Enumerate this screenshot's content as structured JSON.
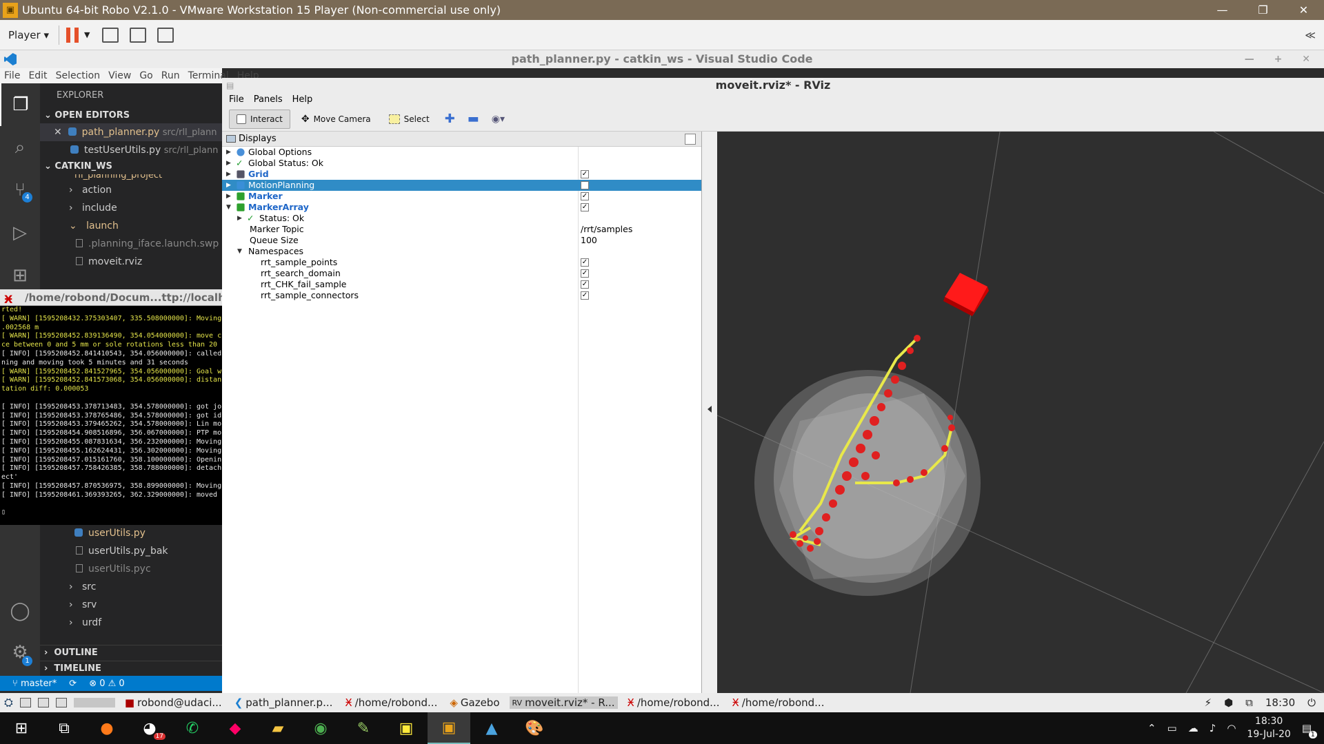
{
  "vm": {
    "title": "Ubuntu 64-bit Robo V2.1.0 - VMware Workstation 15 Player (Non-commercial use only)",
    "player_label": "Player",
    "controls": [
      "—",
      "❐",
      "✕"
    ],
    "fullscreen_toggle": "≪"
  },
  "vscode": {
    "title": "path_planner.py - catkin_ws - Visual Studio Code",
    "menu": [
      "File",
      "Edit",
      "Selection",
      "View",
      "Go",
      "Run",
      "Terminal",
      "Help"
    ],
    "explorer_label": "EXPLORER",
    "open_editors_label": "OPEN EDITORS",
    "open_editors": [
      {
        "name": "path_planner.py",
        "path": "src/rll_plann"
      },
      {
        "name": "testUserUtils.py",
        "path": "src/rll_plann"
      }
    ],
    "workspace_label": "CATKIN_WS",
    "project_partial": "rll_planning_project",
    "tree_top": [
      {
        "name": "action",
        "type": "folder",
        "open": false
      },
      {
        "name": "include",
        "type": "folder",
        "open": false
      },
      {
        "name": "launch",
        "type": "folder",
        "open": true
      },
      {
        "name": ".planning_iface.launch.swp",
        "type": "file"
      },
      {
        "name": "moveit.rviz",
        "type": "file"
      }
    ],
    "tree_bottom": [
      {
        "name": "userUtils.py",
        "type": "py"
      },
      {
        "name": "userUtils.py_bak",
        "type": "file"
      },
      {
        "name": "userUtils.pyc",
        "type": "file"
      },
      {
        "name": "src",
        "type": "folder"
      },
      {
        "name": "srv",
        "type": "folder"
      },
      {
        "name": "urdf",
        "type": "folder"
      }
    ],
    "outline_label": "OUTLINE",
    "timeline_label": "TIMELINE",
    "source_control_badge": "4",
    "settings_badge": "1",
    "status": {
      "branch": "master*",
      "problems": "⊗ 0 ⚠ 0"
    }
  },
  "terminal": {
    "title": "/home/robond/Docum...ttp://localh",
    "lines": [
      {
        "t": "rted!",
        "c": "w"
      },
      {
        "t": "[ WARN] [1595208432.375303407, 335.508000000]: Moving",
        "c": "w"
      },
      {
        "t": ".002568 m",
        "c": "w"
      },
      {
        "t": "[ WARN] [1595208452.839136490, 354.054000000]: move c",
        "c": "w"
      },
      {
        "t": "ce between 0 and 5 mm or sole rotations less than 20",
        "c": "w"
      },
      {
        "t": "[ INFO] [1595208452.841410543, 354.056000000]: called",
        "c": "i"
      },
      {
        "t": "ning and moving took 5 minutes and 31 seconds",
        "c": "i"
      },
      {
        "t": "[ WARN] [1595208452.841527965, 354.056000000]: Goal w",
        "c": "w"
      },
      {
        "t": "[ WARN] [1595208452.841573068, 354.056000000]: distan",
        "c": "w"
      },
      {
        "t": "tation diff: 0.000053",
        "c": "w"
      },
      {
        "t": "",
        "c": "i"
      },
      {
        "t": "[ INFO] [1595208453.378713483, 354.578000000]: got jo",
        "c": "i"
      },
      {
        "t": "[ INFO] [1595208453.378765486, 354.578000000]: got id",
        "c": "i"
      },
      {
        "t": "[ INFO] [1595208453.379465262, 354.578000000]: Lin mo",
        "c": "i"
      },
      {
        "t": "[ INFO] [1595208454.908516896, 356.067000000]: PTP mo",
        "c": "i"
      },
      {
        "t": "[ INFO] [1595208455.087831634, 356.232000000]: Moving",
        "c": "i"
      },
      {
        "t": "[ INFO] [1595208455.162624431, 356.302000000]: Moving",
        "c": "i"
      },
      {
        "t": "[ INFO] [1595208457.015161760, 358.100000000]: Openin",
        "c": "i"
      },
      {
        "t": "[ INFO] [1595208457.758426385, 358.788000000]: detach",
        "c": "i"
      },
      {
        "t": "ect'",
        "c": "i"
      },
      {
        "t": "[ INFO] [1595208457.870536975, 358.899000000]: Moving",
        "c": "i"
      },
      {
        "t": "[ INFO] [1595208461.369393265, 362.329000000]: moved",
        "c": "i"
      },
      {
        "t": "",
        "c": "i"
      },
      {
        "t": "▯",
        "c": "i"
      }
    ]
  },
  "rviz": {
    "title": "moveit.rviz* - RViz",
    "menu": [
      "File",
      "Panels",
      "Help"
    ],
    "tools": [
      "Interact",
      "Move Camera",
      "Select"
    ],
    "displays_label": "Displays",
    "rows": [
      {
        "label": "Global Options",
        "indent": 0,
        "arrow": "▶",
        "icon": "globe"
      },
      {
        "label": "Global Status: Ok",
        "indent": 0,
        "arrow": "▶",
        "icon": "check"
      },
      {
        "label": "Grid",
        "indent": 0,
        "arrow": "▶",
        "icon": "grid",
        "bold": true,
        "check": "✓"
      },
      {
        "label": "MotionPlanning",
        "indent": 0,
        "arrow": "▶",
        "icon": "mp",
        "selected": true,
        "check": ""
      },
      {
        "label": "Marker",
        "indent": 0,
        "arrow": "▶",
        "icon": "marker",
        "bold": true,
        "check": "✓"
      },
      {
        "label": "MarkerArray",
        "indent": 0,
        "arrow": "▼",
        "icon": "markers",
        "bold": true,
        "check": "✓"
      },
      {
        "label": "Status: Ok",
        "indent": 1,
        "arrow": "▶",
        "icon": "check"
      },
      {
        "label": "Marker Topic",
        "indent": 1,
        "value": "/rrt/samples"
      },
      {
        "label": "Queue Size",
        "indent": 1,
        "value": "100"
      },
      {
        "label": "Namespaces",
        "indent": 1,
        "arrow": "▼"
      },
      {
        "label": "rrt_sample_points",
        "indent": 2,
        "check": "✓"
      },
      {
        "label": "rrt_search_domain",
        "indent": 2,
        "check": "✓"
      },
      {
        "label": "rrt_CHK_fail_sample",
        "indent": 2,
        "check": "✓"
      },
      {
        "label": "rrt_sample_connectors",
        "indent": 2,
        "check": "✓"
      }
    ]
  },
  "ubuntu_taskbar": {
    "items": [
      "robond@udaci...",
      "path_planner.p...",
      "/home/robond...",
      "Gazebo",
      "moveit.rviz* - R...",
      "/home/robond...",
      "/home/robond..."
    ],
    "active_index": 4,
    "time": "18:30"
  },
  "windows_taskbar": {
    "time": "18:30",
    "date": "19-Jul-20",
    "notification_count": "1",
    "chrome_badge": "17"
  }
}
